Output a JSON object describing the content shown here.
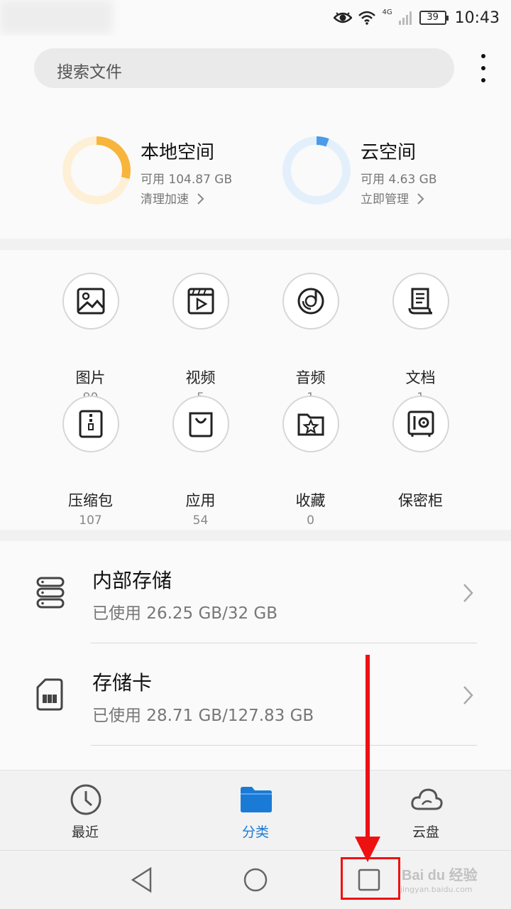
{
  "status_bar": {
    "time": "10:43",
    "battery": "39",
    "network": "4G",
    "icons": [
      "eye-comfort-icon",
      "wifi-icon",
      "signal-icon",
      "battery-icon"
    ]
  },
  "search": {
    "placeholder": "搜索文件"
  },
  "storage": {
    "local": {
      "title": "本地空间",
      "free": "可用 104.87 GB",
      "action": "清理加速",
      "used_fraction": 0.29,
      "color": "#f8b53b"
    },
    "cloud": {
      "title": "云空间",
      "free": "可用 4.63 GB",
      "action": "立即管理",
      "used_fraction": 0.06,
      "color": "#4a9be8"
    }
  },
  "categories": [
    {
      "name": "图片",
      "count": "90",
      "icon": "picture-icon"
    },
    {
      "name": "视频",
      "count": "5",
      "icon": "video-icon"
    },
    {
      "name": "音频",
      "count": "1",
      "icon": "audio-icon"
    },
    {
      "name": "文档",
      "count": "1",
      "icon": "document-icon"
    },
    {
      "name": "压缩包",
      "count": "107",
      "icon": "archive-icon"
    },
    {
      "name": "应用",
      "count": "54",
      "icon": "app-bag-icon"
    },
    {
      "name": "收藏",
      "count": "0",
      "icon": "favorite-folder-icon"
    },
    {
      "name": "保密柜",
      "count": "",
      "icon": "safe-icon"
    }
  ],
  "locations": [
    {
      "title": "内部存储",
      "usage": "已使用 26.25 GB/32 GB",
      "icon": "internal-storage-icon"
    },
    {
      "title": "存储卡",
      "usage": "已使用 28.71 GB/127.83 GB",
      "icon": "sd-card-icon"
    }
  ],
  "tabs": [
    {
      "label": "最近",
      "icon": "clock-icon",
      "active": false
    },
    {
      "label": "分类",
      "icon": "folder-icon",
      "active": true
    },
    {
      "label": "云盘",
      "icon": "cloud-icon",
      "active": false
    }
  ],
  "nav": [
    "back-icon",
    "home-icon",
    "recents-icon"
  ],
  "colors": {
    "accent": "#1a7bd6",
    "annotation": "#ee1111"
  },
  "watermark": {
    "brand": "Bai du 经验",
    "url": "jingyan.baidu.com"
  }
}
